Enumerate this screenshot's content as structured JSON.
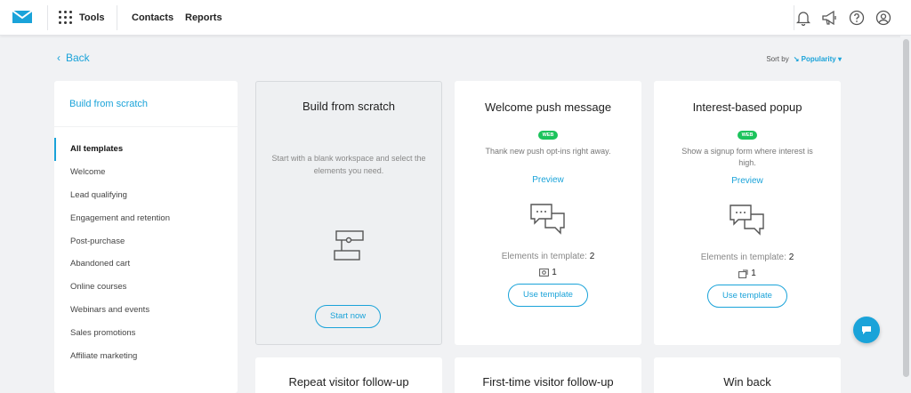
{
  "nav": {
    "tools_label": "Tools",
    "contacts_label": "Contacts",
    "reports_label": "Reports"
  },
  "back_label": "Back",
  "sort": {
    "label": "Sort by",
    "selected": "Popularity"
  },
  "sidebar": {
    "top_link": "Build from scratch",
    "items": [
      {
        "label": "All templates"
      },
      {
        "label": "Welcome"
      },
      {
        "label": "Lead qualifying"
      },
      {
        "label": "Engagement and retention"
      },
      {
        "label": "Post-purchase"
      },
      {
        "label": "Abandoned cart"
      },
      {
        "label": "Online courses"
      },
      {
        "label": "Webinars and events"
      },
      {
        "label": "Sales promotions"
      },
      {
        "label": "Affiliate marketing"
      }
    ]
  },
  "scratch_card": {
    "title": "Build from scratch",
    "description": "Start with a blank workspace and select the elements you need.",
    "button": "Start now"
  },
  "cards": [
    {
      "title": "Welcome push message",
      "badge": "WEB",
      "description": "Thank new push opt-ins right away.",
      "preview": "Preview",
      "elements_label": "Elements in template:",
      "elements_count": "2",
      "item_count": "1",
      "button": "Use template"
    },
    {
      "title": "Interest-based popup",
      "badge": "WEB",
      "description": "Show a signup form where interest is high.",
      "preview": "Preview",
      "elements_label": "Elements in template:",
      "elements_count": "2",
      "item_count": "1",
      "button": "Use template"
    }
  ],
  "row2_titles": [
    "Repeat visitor follow-up",
    "First-time visitor follow-up",
    "Win back"
  ],
  "colors": {
    "accent": "#1aa3d9",
    "badge": "#1cc35c",
    "background": "#f1f2f4"
  }
}
